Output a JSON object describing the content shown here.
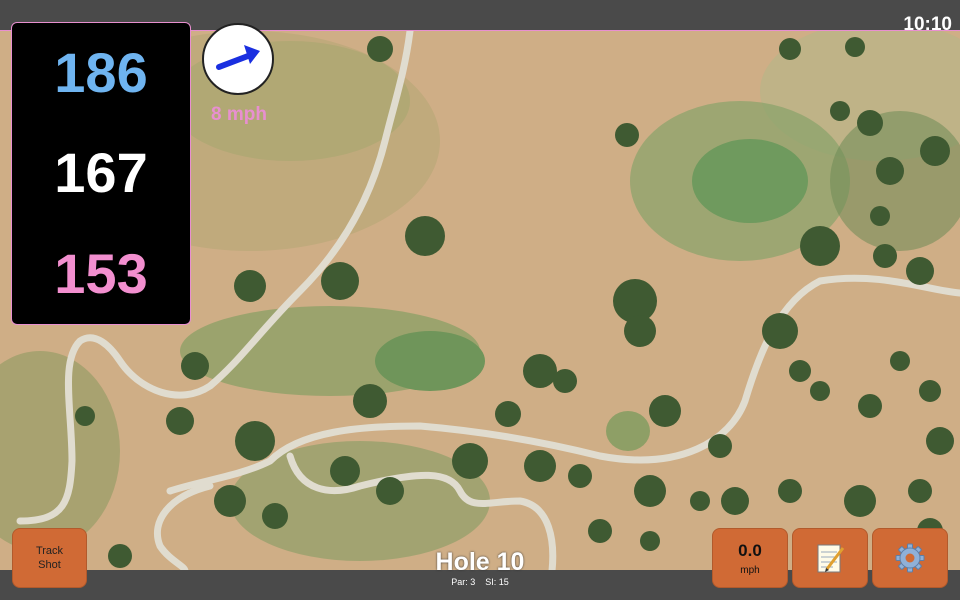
{
  "status_bar": {
    "time": "10:10"
  },
  "distances": {
    "back": "186",
    "middle": "167",
    "front": "153"
  },
  "colors": {
    "back": "#6fb4f0",
    "middle": "#ffffff",
    "front": "#f28fcf",
    "accent": "#e88fd0",
    "button": "#d06a35",
    "arrow": "#1a2fe0"
  },
  "wind": {
    "speed": "8 mph",
    "icon": "wind-direction-arrow-icon"
  },
  "buttons": {
    "track_shot_line1": "Track",
    "track_shot_line2": "Shot",
    "speed_value": "0.0",
    "speed_unit": "mph",
    "notes_icon": "notepad-icon",
    "settings_icon": "gear-icon"
  },
  "hole": {
    "title": "Hole 10",
    "par": "Par: 3",
    "si": "SI: 15"
  }
}
